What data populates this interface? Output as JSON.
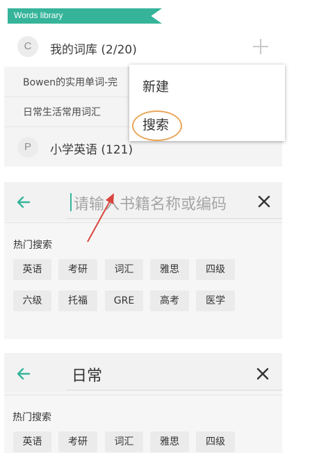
{
  "library_panel": {
    "banner": "Words library",
    "rows": [
      {
        "avatar_letter": "C",
        "title": "我的词库 (2/20)"
      },
      {
        "avatar_letter": "P",
        "title": "小学英语 (121)"
      }
    ],
    "sub_items": [
      "Bowen的实用单词-完",
      "日常生活常用词汇"
    ],
    "menu": {
      "items": [
        "新建",
        "搜索"
      ],
      "highlighted": "搜索"
    }
  },
  "search_panel_empty": {
    "placeholder": "请输入书籍名称或编码",
    "section_title": "热门搜索",
    "chips_row1": [
      "英语",
      "考研",
      "词汇",
      "雅思",
      "四级"
    ],
    "chips_row2": [
      "六级",
      "托福",
      "GRE",
      "高考",
      "医学"
    ]
  },
  "search_panel_filled": {
    "query": "日常",
    "section_title": "热门搜索",
    "chips_row1": [
      "英语",
      "考研",
      "词汇",
      "雅思",
      "四级"
    ]
  },
  "colors": {
    "accent": "#35b49a",
    "highlight_ring": "#e9a65b",
    "annotation_arrow": "#d9443c"
  },
  "icons": [
    "back-arrow-icon",
    "close-icon",
    "plus-icon"
  ]
}
